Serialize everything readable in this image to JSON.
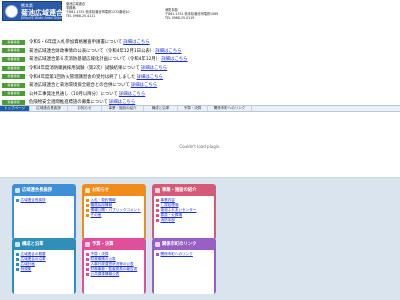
{
  "header": {
    "logo_sub": "熊本県",
    "logo_main": "菊池広域連合",
    "logo_en": "Kikuchi Wide Area Union",
    "info_lines": [
      "菊池広域連合",
      "事務局",
      "〒861-1331 熊本県菊池市隈府1272番地10",
      "TEL 0968-25-4111",
      "FAX 0968-25-1134"
    ],
    "info_col2": [
      "消防本部",
      "〒861-1331 熊本県菊池市隈府1069",
      "TEL 0968-25-0119"
    ]
  },
  "news": {
    "badge": "新着情報",
    "link_text": "詳細はこちら",
    "items": [
      {
        "text": "令和5・6年度入札参加資格審査申請書について"
      },
      {
        "text": "菊池広域連合財政事情の公表について（令和4年12月1日公表）"
      },
      {
        "text": "菊池広域連合第６次消防基礎広域化計画について（令和4年12月）"
      },
      {
        "text": "令和4年度消防職員採用試験（第2次）試験結果について"
      },
      {
        "text": "令和4年度第1回防火管理講習会の受付は終了しました"
      },
      {
        "text": "菊池広域連合と菊池環境保全組合との合併について"
      },
      {
        "text": "公共工事発注見通し（10月以降分）について"
      },
      {
        "text": "危険物安全週間推進標語の募集について"
      }
    ]
  },
  "nav": {
    "items": [
      "トップページ",
      "広域連合長挨拶",
      "お知らせ",
      "事業・施設の紹介",
      "構成と沿革",
      "予算・決算",
      "関係市町へのリンク"
    ]
  },
  "plugin": {
    "message": "Couldn't load plugin."
  },
  "panels": {
    "colors": [
      "#3f8fd6",
      "#f08c1a",
      "#d45a78",
      "#2f8fb8",
      "#e0509a",
      "#9a5fc4"
    ],
    "items": [
      {
        "title": "広域連合長挨拶",
        "links": [
          "広域連合長挨拶"
        ],
        "link_color": "#3f8fd6"
      },
      {
        "title": "お知らせ",
        "links": [
          "入札・契約情報",
          "職員採用情報",
          "情報公開・パブリックコメント",
          "その他"
        ],
        "link_color": "#f08c1a"
      },
      {
        "title": "事業・施設の紹介",
        "links": [
          "事業内容",
          "し尿処理場",
          "菊池ふれあいセンター",
          "葬斎・火葬場",
          "消防本部"
        ],
        "link_color": "#d45a78"
      },
      {
        "title": "構成と沿革",
        "links": [
          "広域連合の概要",
          "広域連合の沿革",
          "広域計画",
          "例規集"
        ],
        "link_color": "#2f8fb8"
      },
      {
        "title": "予算・決算",
        "links": [
          "予算・決算",
          "財政事情の公表",
          "人事行政運営状況等の公表",
          "財務事務・監査委員の報告書",
          "公共調達情報公表"
        ],
        "link_color": "#e0509a"
      },
      {
        "title": "関係市町のリンク",
        "links": [
          "関係市町へのリンク"
        ],
        "link_color": "#9a5fc4"
      }
    ]
  }
}
